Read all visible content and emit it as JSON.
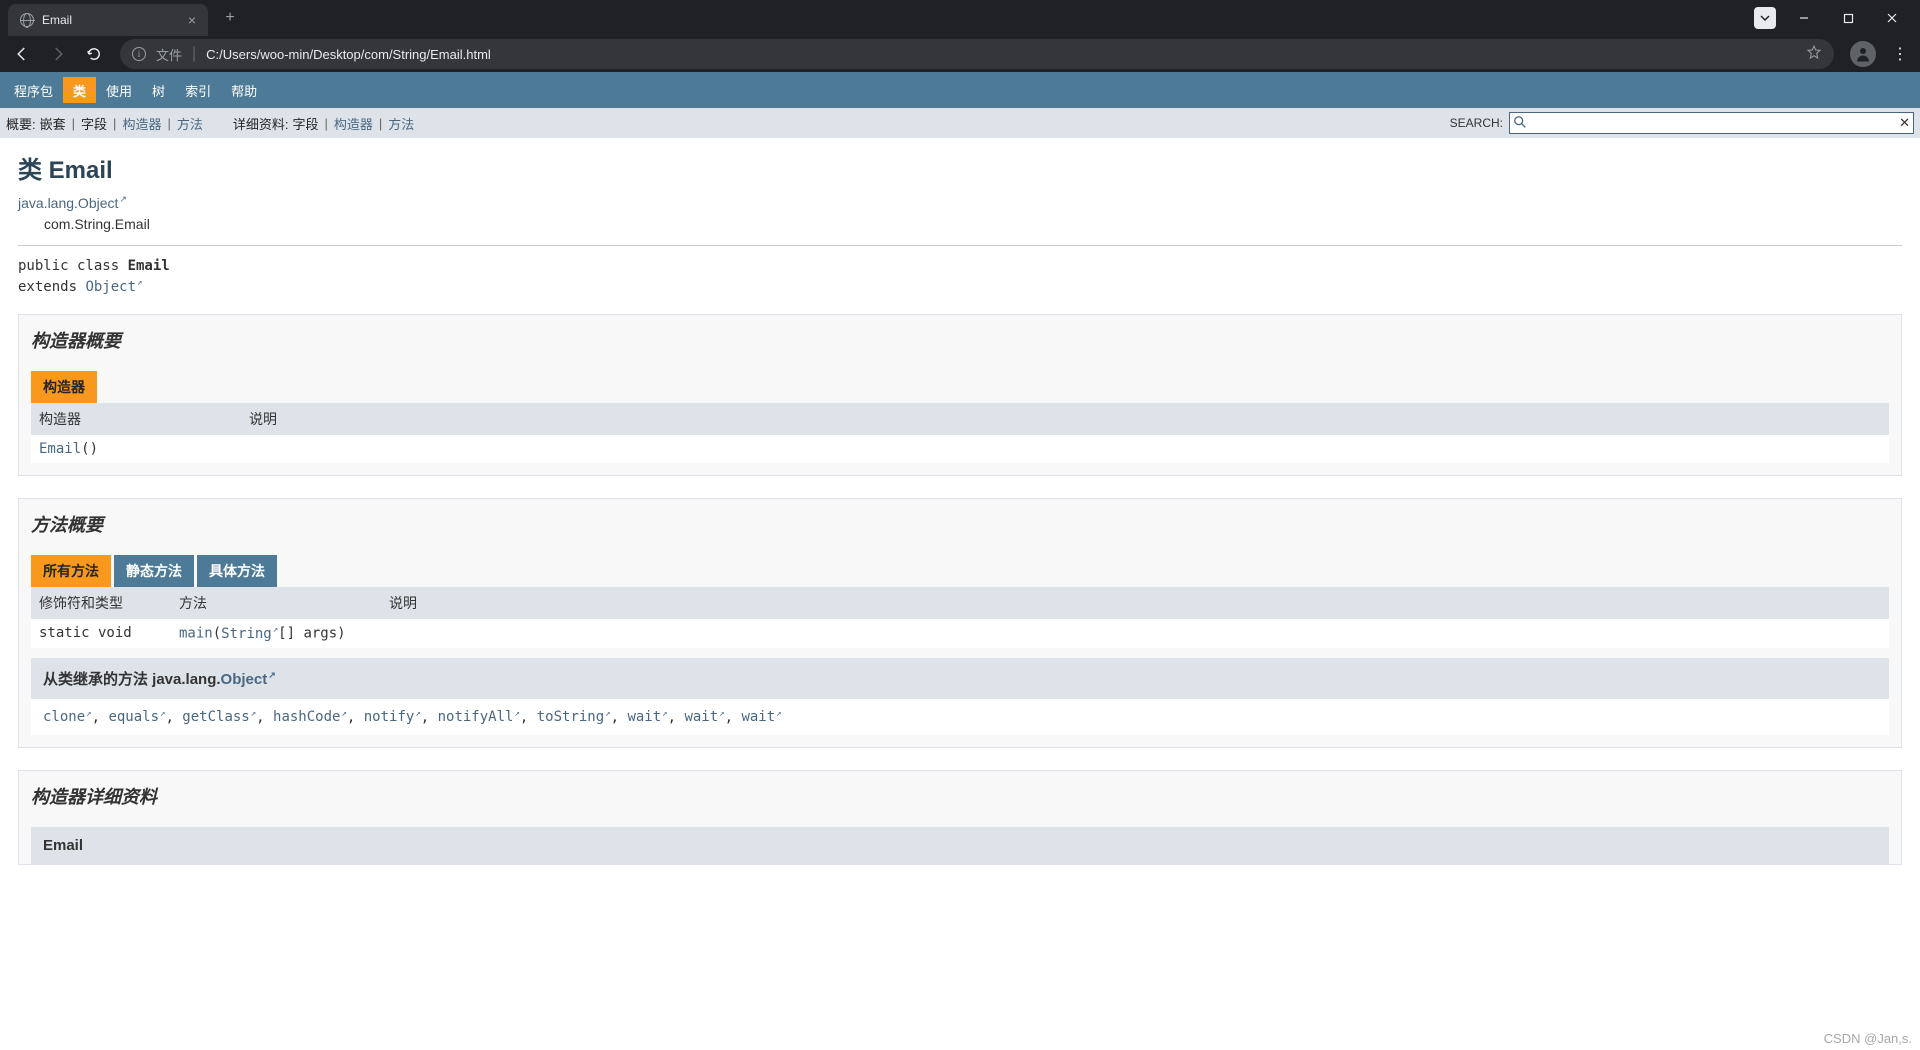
{
  "browser": {
    "tab_title": "Email",
    "url_label": "文件",
    "url_path": "C:/Users/woo-min/Desktop/com/String/Email.html"
  },
  "top_nav": {
    "items": [
      {
        "label": "程序包",
        "selected": false
      },
      {
        "label": "类",
        "selected": true
      },
      {
        "label": "使用",
        "selected": false
      },
      {
        "label": "树",
        "selected": false
      },
      {
        "label": "索引",
        "selected": false
      },
      {
        "label": "帮助",
        "selected": false
      }
    ]
  },
  "sub_nav": {
    "summary_label": "概要:",
    "summary_items": [
      {
        "text": "嵌套",
        "link": false
      },
      {
        "text": "字段",
        "link": false
      },
      {
        "text": "构造器",
        "link": true
      },
      {
        "text": "方法",
        "link": true
      }
    ],
    "detail_label": "详细资料:",
    "detail_items": [
      {
        "text": "字段",
        "link": false
      },
      {
        "text": "构造器",
        "link": true
      },
      {
        "text": "方法",
        "link": true
      }
    ],
    "search_label": "SEARCH:",
    "search_placeholder": ""
  },
  "page": {
    "title": "类 Email",
    "super_class": "java.lang.Object",
    "full_name": "com.String.Email",
    "sig_public_class": "public class ",
    "sig_class_name": "Email",
    "sig_extends": "extends ",
    "sig_super": "Object"
  },
  "constructor_summary": {
    "heading": "构造器概要",
    "tab": "构造器",
    "col_constructor": "构造器",
    "col_desc": "说明",
    "rows": [
      {
        "name": "Email",
        "params": "()",
        "desc": ""
      }
    ]
  },
  "method_summary": {
    "heading": "方法概要",
    "tabs": [
      {
        "label": "所有方法",
        "active": true
      },
      {
        "label": "静态方法",
        "active": false
      },
      {
        "label": "具体方法",
        "active": false
      }
    ],
    "col_modifier": "修饰符和类型",
    "col_method": "方法",
    "col_desc": "说明",
    "rows": [
      {
        "modifier": "static void",
        "name": "main",
        "param_type": "String",
        "param_rest": "[] args)",
        "desc": ""
      }
    ],
    "inherited_prefix": "从类继承的方法 java.lang.",
    "inherited_class": "Object",
    "inherited_methods": [
      "clone",
      "equals",
      "getClass",
      "hashCode",
      "notify",
      "notifyAll",
      "toString",
      "wait",
      "wait",
      "wait"
    ]
  },
  "constructor_detail": {
    "heading": "构造器详细资料",
    "name": "Email"
  },
  "watermark": "CSDN @Jan,s."
}
